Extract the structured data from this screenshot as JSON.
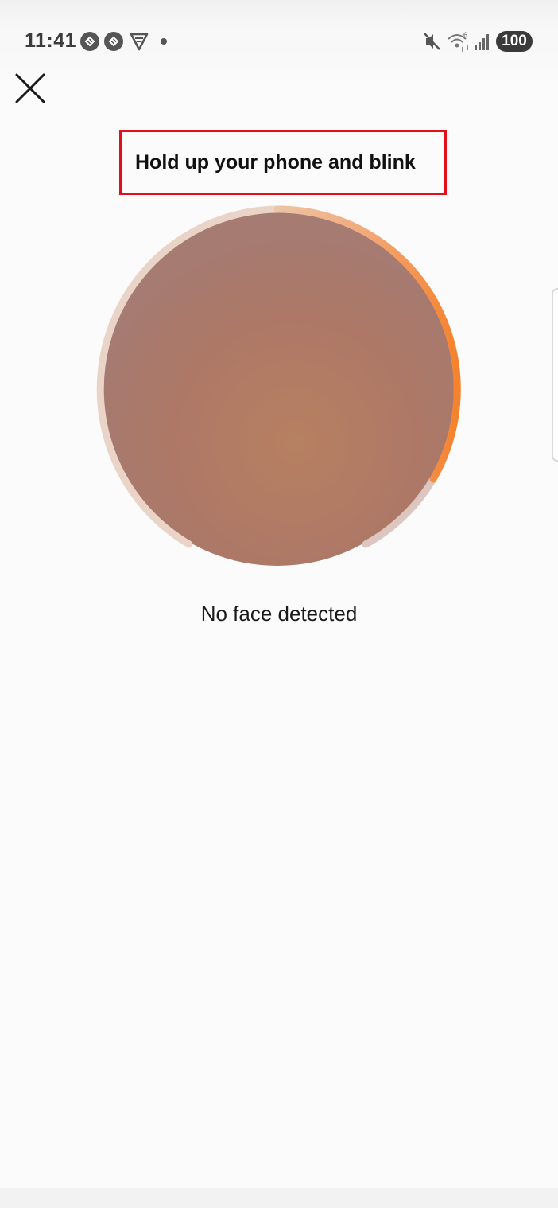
{
  "status_bar": {
    "time": "11:41",
    "battery": "100",
    "icons": [
      "app-notification-icon",
      "app-notification-icon-2",
      "vpn-shield-icon",
      "notification-dot",
      "mute-icon",
      "wifi-icon",
      "signal-icon",
      "battery-icon"
    ]
  },
  "header": {
    "close_icon": "close-icon"
  },
  "main": {
    "instruction": "Hold up your phone and blink",
    "feedback": "No face detected"
  },
  "colors": {
    "highlight_border": "#e3101c",
    "progress_orange": "#f5822d",
    "camera_fill": "#b27f66"
  }
}
